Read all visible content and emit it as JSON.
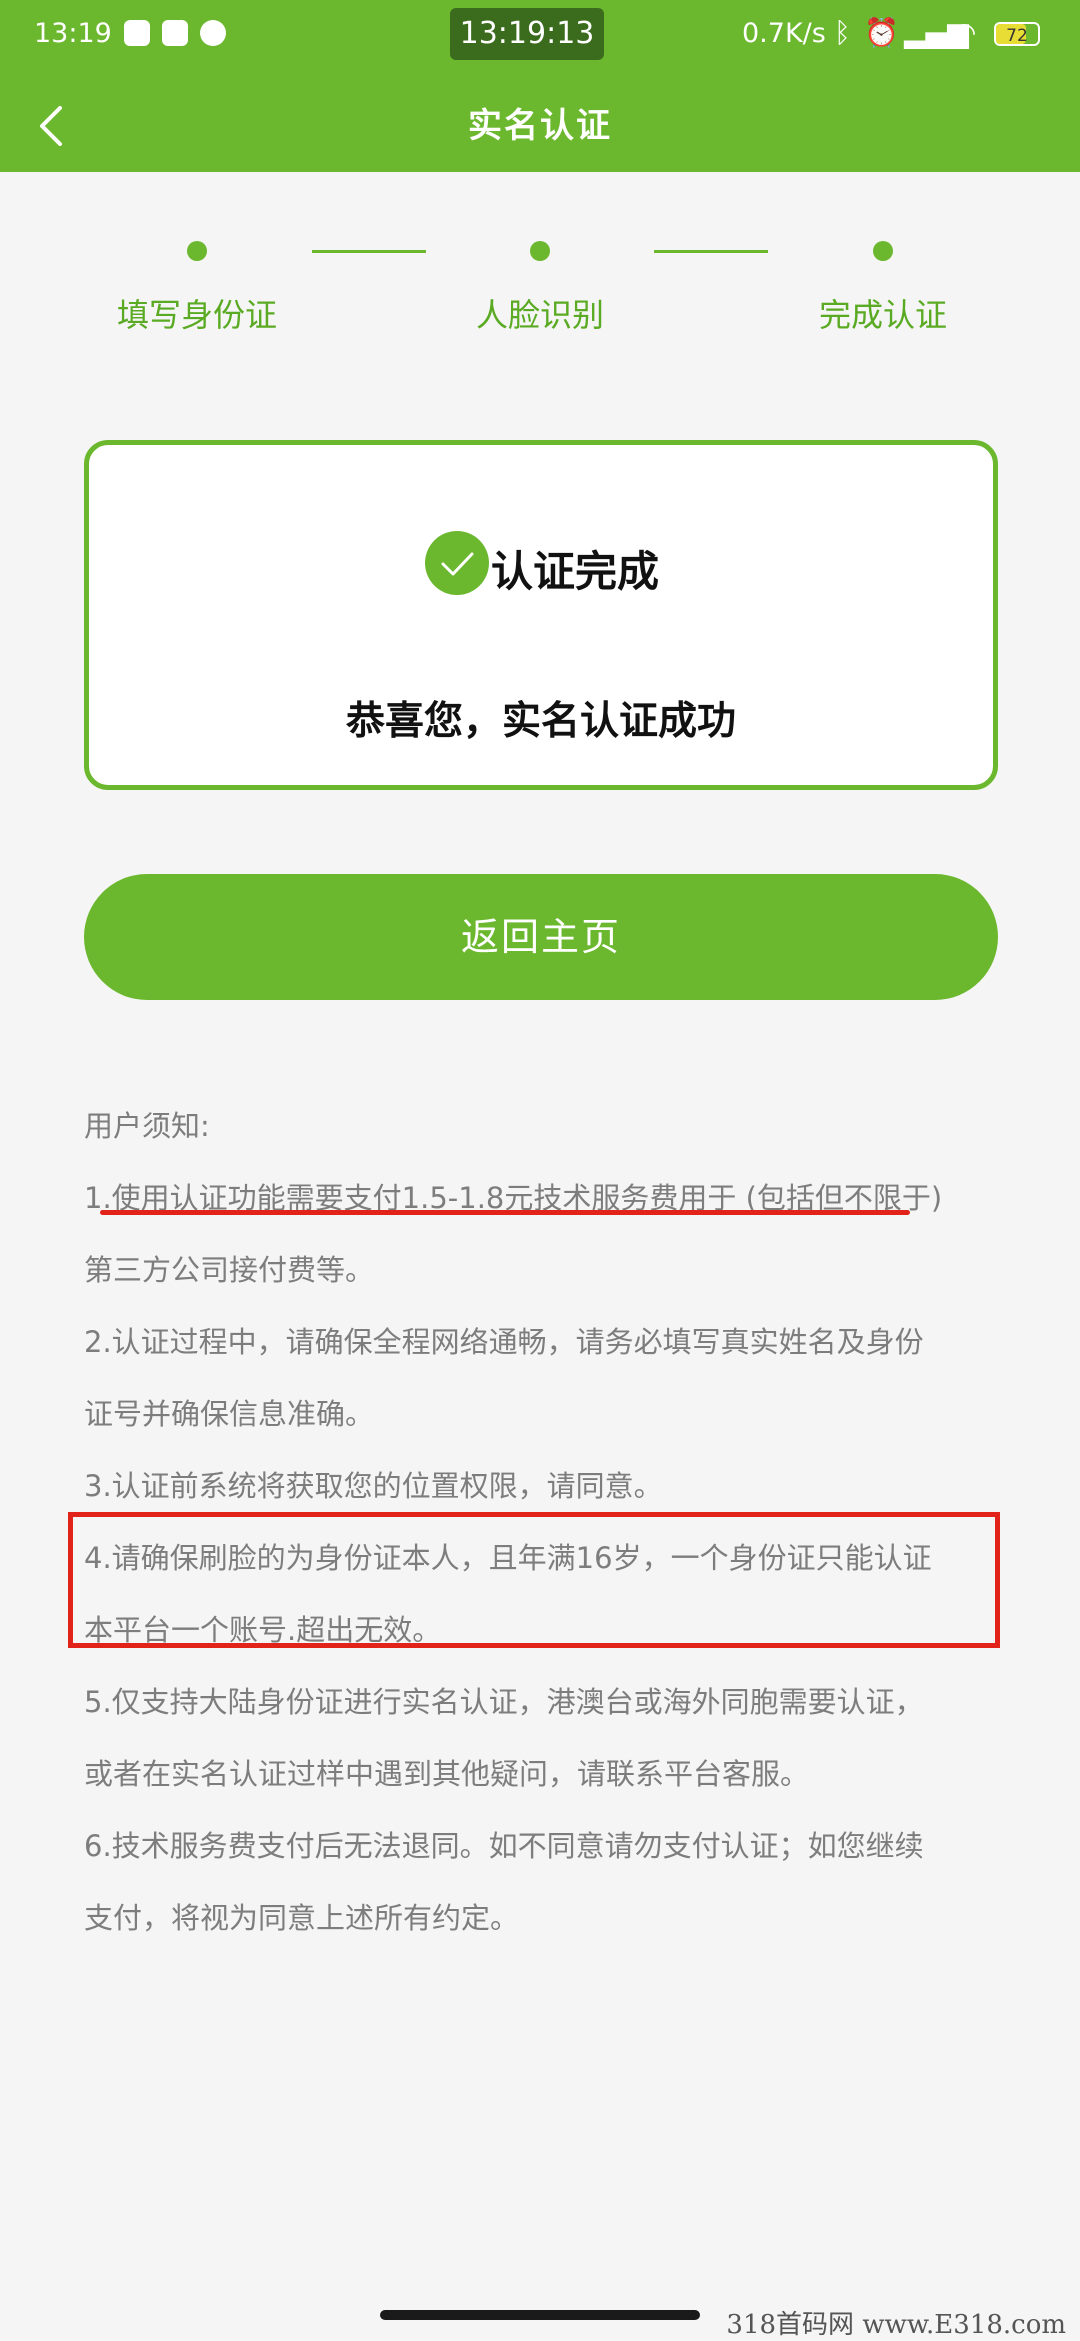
{
  "status_bar": {
    "time": "13:19",
    "center_clock": "13:19:13",
    "net_speed": "0.7K/s",
    "battery": "72"
  },
  "nav": {
    "title": "实名认证"
  },
  "steps": [
    {
      "label": "填写身份证"
    },
    {
      "label": "人脸识别"
    },
    {
      "label": "完成认证"
    }
  ],
  "result": {
    "title": "认证完成",
    "message": "恭喜您，实名认证成功"
  },
  "home_button": {
    "label": "返回主页"
  },
  "notice": {
    "heading": "用户须知:",
    "lines": [
      "1.使用认证功能需要支付1.5-1.8元技术服务费用于 (包括但不限于)",
      "第三方公司接付费等。",
      "2.认证过程中，请确保全程网络通畅，请务必填写真实姓名及身份",
      "证号并确保信息准确。",
      "3.认证前系统将获取您的位置权限，请同意。",
      "4.请确保刷脸的为身份证本人，且年满16岁，一个身份证只能认证",
      "本平台一个账号.超出无效。",
      "5.仅支持大陆身份证进行实名认证，港澳台或海外同胞需要认证，",
      "或者在实名认证过样中遇到其他疑问，请联系平台客服。",
      "6.技术服务费支付后无法退同。如不同意请勿支付认证；如您继续",
      "支付，将视为同意上述所有约定。"
    ]
  },
  "watermark": "318首码网  www.E318.com",
  "colors": {
    "brand_green": "#6bb82e",
    "annotation_red": "#e2231a"
  }
}
